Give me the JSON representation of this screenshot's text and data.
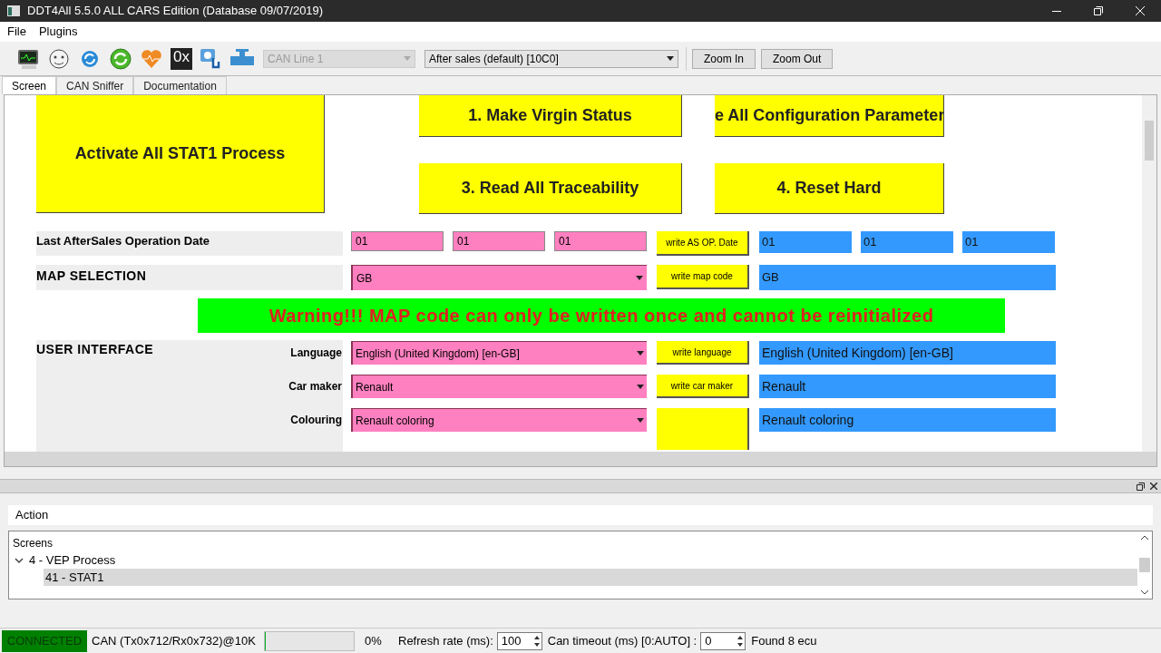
{
  "window": {
    "title": "DDT4All 5.5.0 ALL CARS Edition (Database 09/07/2019)"
  },
  "menu": [
    "File",
    "Plugins"
  ],
  "toolbar": {
    "hex_label": "0x",
    "can_line": {
      "value": "CAN Line 1",
      "disabled": true
    },
    "session": "After sales (default) [10C0]",
    "buttons": [
      "Zoom In",
      "Zoom Out"
    ]
  },
  "tabs": [
    {
      "label": "Screen",
      "selected": true
    },
    {
      "label": "CAN Sniffer",
      "selected": false
    },
    {
      "label": "Documentation",
      "selected": false
    }
  ],
  "screen": {
    "main_action": "Activate All STAT1 Process",
    "actions": [
      "1. Make Virgin Status",
      "e All Configuration Parameter",
      "3. Read All Traceability",
      "4. Reset Hard"
    ],
    "date_row": {
      "label": "Last AfterSales Operation Date",
      "inputs": [
        "01",
        "01",
        "01"
      ],
      "button": "write AS OP. Date",
      "readings": [
        "01",
        "01",
        "01"
      ]
    },
    "map_row": {
      "label": "MAP SELECTION",
      "select": "GB",
      "button": "write map code",
      "reading": "GB"
    },
    "warning": "Warning!!! MAP code can only be written once and cannot be reinitialized",
    "user_interface": {
      "label": "USER INTERFACE",
      "params": [
        {
          "name": "Language",
          "select": "English (United Kingdom) [en-GB]",
          "button": "write language",
          "reading": "English (United Kingdom) [en-GB]"
        },
        {
          "name": "Car maker",
          "select": "Renault",
          "button": "write car maker",
          "reading": "Renault"
        },
        {
          "name": "Colouring",
          "select": "Renault coloring",
          "reading": "Renault coloring"
        }
      ]
    }
  },
  "dock": {
    "action": "Action",
    "tree": {
      "header": "Screens",
      "nodes": [
        {
          "label": "4 - VEP Process",
          "expanded": true,
          "children": [
            {
              "label": "41 - STAT1",
              "selected": true
            }
          ]
        }
      ]
    }
  },
  "status_bar": {
    "connection": {
      "label": "CONNECTED",
      "connected": true
    },
    "can": "CAN (Tx0x712/Rx0x732)@10K",
    "progress": {
      "level": 0,
      "reading": "0%"
    },
    "refresh_label": "Refresh rate (ms):",
    "refresh_value": "100",
    "timeout_label": "Can timeout (ms) [0:AUTO] :",
    "timeout_value": "0",
    "found": "Found 8 ecu"
  }
}
